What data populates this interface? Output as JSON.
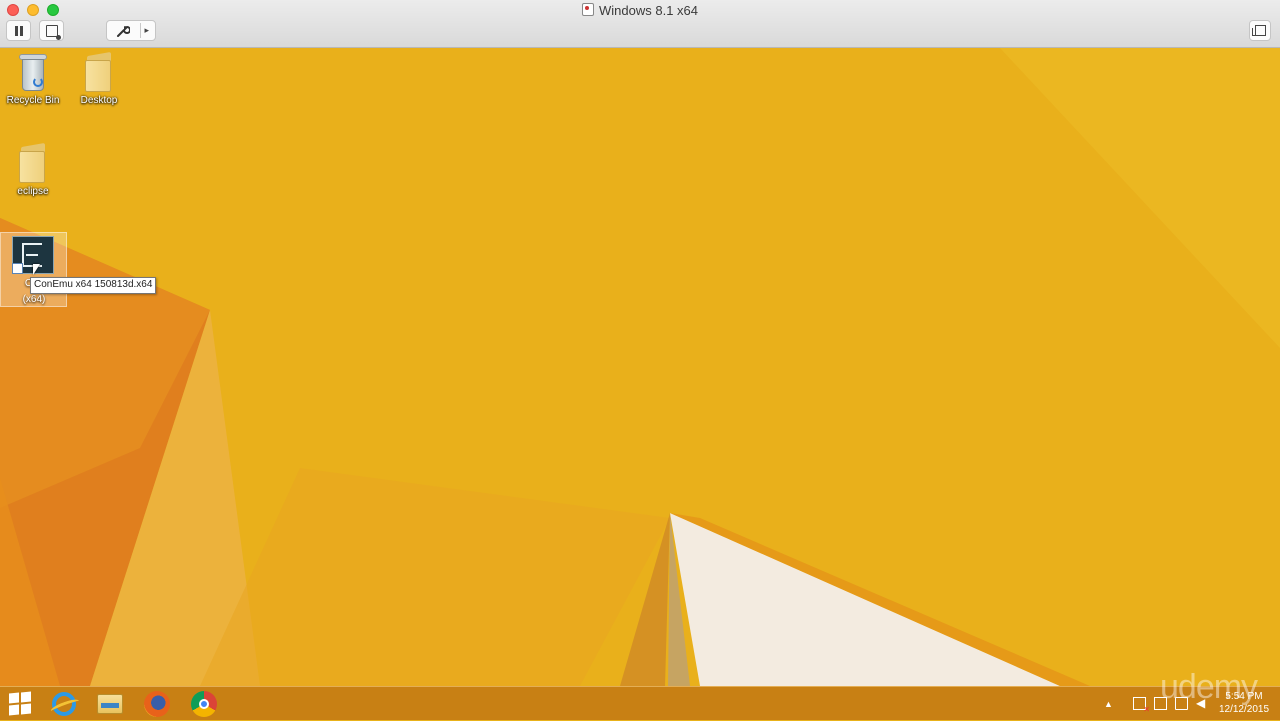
{
  "window": {
    "title": "Windows 8.1 x64"
  },
  "toolbar": {
    "tools_caret": "▸"
  },
  "desktop_icons": {
    "recycle_bin": "Recycle Bin",
    "desktop_folder": "Desktop",
    "eclipse_folder": "eclipse",
    "conemu_line1": "Con",
    "conemu_line2": "(x64)"
  },
  "tooltip": {
    "text": "ConEmu x64 150813d.x64"
  },
  "taskbar": {
    "pinned": [
      "Start",
      "Internet Explorer",
      "File Explorer",
      "Firefox",
      "Chrome"
    ],
    "tray_overflow": "▲",
    "clock_time": "5:54 PM",
    "clock_date": "12/12/2015"
  },
  "watermark": "udemy",
  "colors": {
    "wallpaper": "#e9b21a",
    "taskbar": "#c47c14"
  }
}
